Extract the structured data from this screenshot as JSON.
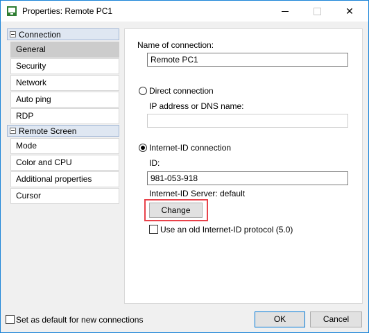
{
  "window": {
    "title": "Properties: Remote PC1"
  },
  "nav": {
    "groups": [
      {
        "label": "Connection",
        "items": [
          "General",
          "Security",
          "Network",
          "Auto ping",
          "RDP"
        ]
      },
      {
        "label": "Remote Screen",
        "items": [
          "Mode",
          "Color and CPU",
          "Additional properties",
          "Cursor"
        ]
      }
    ],
    "selected": "General"
  },
  "general": {
    "name_label": "Name of connection:",
    "name_value": "Remote PC1",
    "direct_label": "Direct connection",
    "ip_label": "IP address or DNS name:",
    "ip_value": "",
    "internet_id_label": "Internet-ID connection",
    "selected_mode": "Internet-ID connection",
    "id_label": "ID:",
    "id_value": "981-053-918",
    "server_label": "Internet-ID Server: default",
    "change_label": "Change",
    "old_protocol_label": "Use an old Internet-ID protocol (5.0)",
    "old_protocol_checked": false
  },
  "footer": {
    "default_label": "Set as default for new connections",
    "default_checked": false,
    "ok_label": "OK",
    "cancel_label": "Cancel"
  },
  "colors": {
    "window_border": "#1883d7",
    "highlight": "#e8424a",
    "selected_item": "#cccccc"
  }
}
